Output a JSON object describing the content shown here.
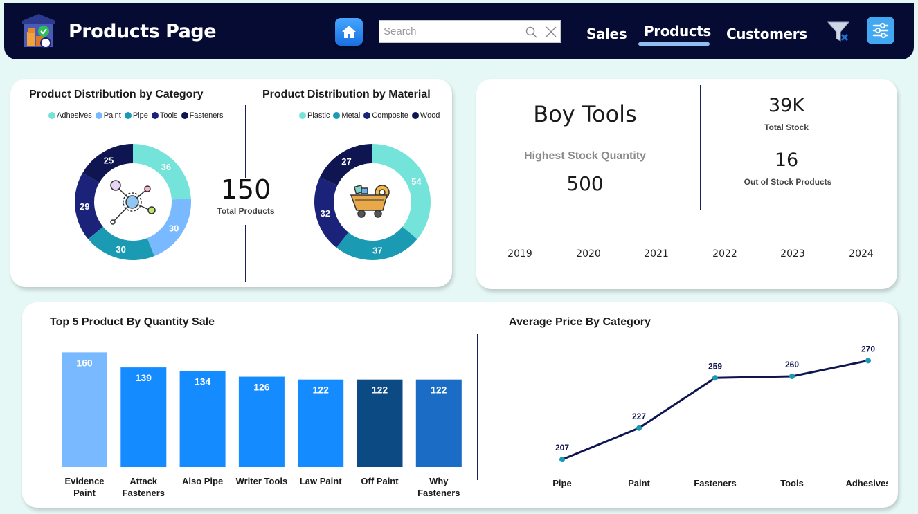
{
  "header": {
    "title": "Products Page",
    "search_placeholder": "Search",
    "nav": {
      "sales": "Sales",
      "products": "Products",
      "customers": "Customers"
    },
    "active_nav": "Products"
  },
  "category_chart": {
    "title": "Product Distribution by Category",
    "legend": [
      "Adhesives",
      "Paint",
      "Pipe",
      "Tools",
      "Fasteners"
    ]
  },
  "material_chart": {
    "title": "Product Distribution by Material",
    "legend": [
      "Plastic",
      "Metal",
      "Composite",
      "Wood"
    ]
  },
  "total_products": {
    "value": "150",
    "label": "Total Products"
  },
  "stock": {
    "brand": "Boy Tools",
    "highest_label": "Highest Stock Quantity",
    "highest_value": "500",
    "total_stock_value": "39K",
    "total_stock_label": "Total Stock",
    "out_of_stock_value": "16",
    "out_of_stock_label": "Out of Stock Products",
    "years": [
      "2019",
      "2020",
      "2021",
      "2022",
      "2023",
      "2024"
    ]
  },
  "bar_section": {
    "title": "Top 5 Product By Quantity Sale"
  },
  "line_section": {
    "title": "Average Price By Category"
  },
  "colors": {
    "header_bg": "#050b33",
    "adhesives": "#74e3d9",
    "paint": "#78b9ff",
    "pipe": "#1b9bb3",
    "tools": "#1b227a",
    "fasteners": "#0e1550",
    "bar_light": "#78b9ff",
    "bar_main": "#148cff",
    "bar_dark": "#0b4a83",
    "bar_mid": "#1a6cc4",
    "line": "#0e1550",
    "marker": "#1b9bb3"
  },
  "chart_data": [
    {
      "type": "pie",
      "title": "Product Distribution by Category",
      "categories": [
        "Adhesives",
        "Paint",
        "Pipe",
        "Tools",
        "Fasteners"
      ],
      "values": [
        36,
        30,
        30,
        29,
        25
      ]
    },
    {
      "type": "pie",
      "title": "Product Distribution by Material",
      "categories": [
        "Plastic",
        "Metal",
        "Composite",
        "Wood"
      ],
      "values": [
        54,
        37,
        32,
        27
      ]
    },
    {
      "type": "bar",
      "title": "Top 5 Product By Quantity Sale",
      "categories": [
        "Evidence Paint",
        "Attack Fasteners",
        "Also Pipe",
        "Writer Tools",
        "Law Paint",
        "Off Paint",
        "Why Fasteners"
      ],
      "category_lines": [
        [
          "Evidence",
          "Paint"
        ],
        [
          "Attack",
          "Fasteners"
        ],
        [
          "Also Pipe"
        ],
        [
          "Writer Tools"
        ],
        [
          "Law Paint"
        ],
        [
          "Off Paint"
        ],
        [
          "Why",
          "Fasteners"
        ]
      ],
      "values": [
        160,
        139,
        134,
        126,
        122,
        122,
        122
      ],
      "ylim": [
        0,
        170
      ]
    },
    {
      "type": "line",
      "title": "Average Price By Category",
      "categories": [
        "Pipe",
        "Paint",
        "Fasteners",
        "Tools",
        "Adhesives"
      ],
      "values": [
        207,
        227,
        259,
        260,
        270
      ],
      "ylim": [
        200,
        275
      ]
    }
  ]
}
